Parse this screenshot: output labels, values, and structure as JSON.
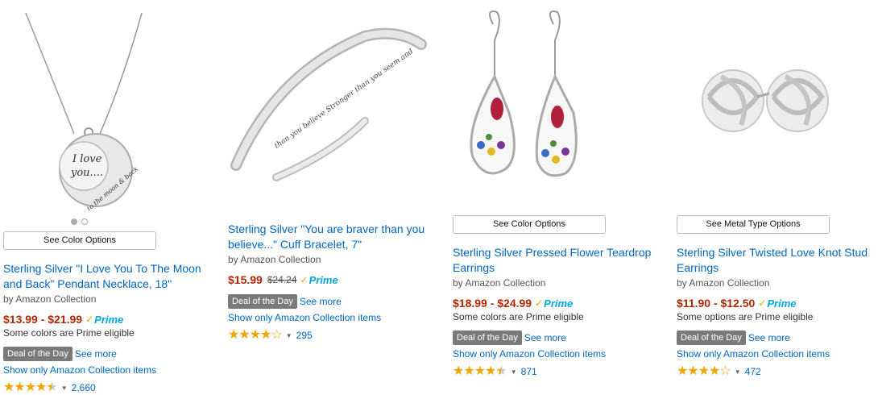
{
  "products": [
    {
      "options_label": "See Color Options",
      "title": "Sterling Silver \"I Love You To The Moon and Back\" Pendant Necklace, 18\"",
      "byline": "by Amazon Collection",
      "price": "$13.99 - $21.99",
      "list_price": "",
      "prime": "Prime",
      "eligible_note": "Some colors are Prime eligible",
      "deal_label": "Deal of the Day",
      "see_more": "See more",
      "show_only": "Show only Amazon Collection items",
      "rating": 4.5,
      "review_count": "2,660",
      "image_text_1": "I love",
      "image_text_2": "you....",
      "image_text_3": "to the moon & back"
    },
    {
      "options_label": "",
      "title": "Sterling Silver \"You are braver than you believe...\" Cuff Bracelet, 7\"",
      "byline": "by Amazon Collection",
      "price": "$15.99",
      "list_price": "$24.24",
      "prime": "Prime",
      "eligible_note": "",
      "deal_label": "Deal of the Day",
      "see_more": "See more",
      "show_only": "Show only Amazon Collection items",
      "rating": 4.0,
      "review_count": "295",
      "image_text_1": "than you believe Stronger than you seem and"
    },
    {
      "options_label": "See Color Options",
      "title": "Sterling Silver Pressed Flower Teardrop Earrings",
      "byline": "by Amazon Collection",
      "price": "$18.99 - $24.99",
      "list_price": "",
      "prime": "Prime",
      "eligible_note": "Some colors are Prime eligible",
      "deal_label": "Deal of the Day",
      "see_more": "See more",
      "show_only": "Show only Amazon Collection items",
      "rating": 4.5,
      "review_count": "871"
    },
    {
      "options_label": "See Metal Type Options",
      "title": "Sterling Silver Twisted Love Knot Stud Earrings",
      "byline": "by Amazon Collection",
      "price": "$11.90 - $12.50",
      "list_price": "",
      "prime": "Prime",
      "eligible_note": "Some options are Prime eligible",
      "deal_label": "Deal of the Day",
      "see_more": "See more",
      "show_only": "Show only Amazon Collection items",
      "rating": 4.0,
      "review_count": "472"
    }
  ],
  "colors": {
    "link": "#0066c0",
    "price": "#b12704",
    "star": "#f0a400",
    "prime": "#00a8e1",
    "deal_badge": "#7a7a7a"
  }
}
